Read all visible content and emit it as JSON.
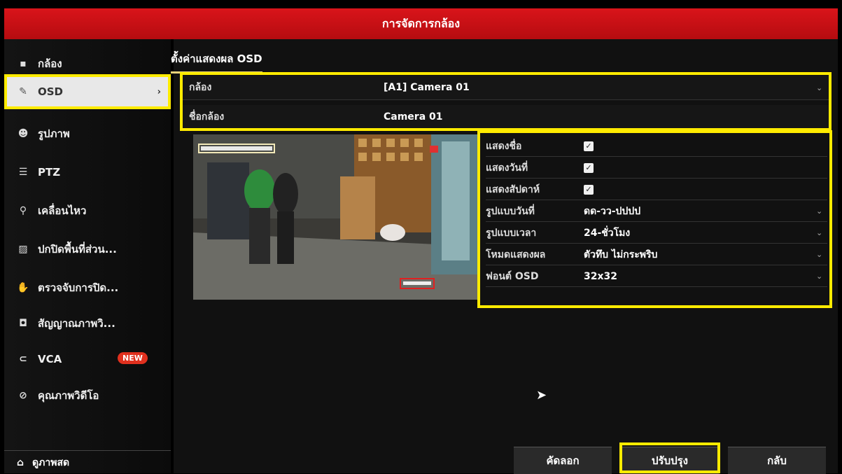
{
  "window": {
    "title": "การจัดการกล้อง"
  },
  "sidebar": {
    "items": [
      {
        "label": "กล้อง",
        "icon": "camera-icon",
        "glyph": "▪"
      },
      {
        "label": "OSD",
        "icon": "osd-edit-icon",
        "glyph": "✎",
        "active": true
      },
      {
        "label": "รูปภาพ",
        "icon": "image-icon",
        "glyph": "☻"
      },
      {
        "label": "PTZ",
        "icon": "ptz-icon",
        "glyph": "☰"
      },
      {
        "label": "เคลื่อนไหว",
        "icon": "motion-icon",
        "glyph": "⚲"
      },
      {
        "label": "ปกปิดพื้นที่ส่วน...",
        "icon": "privacy-mask-icon",
        "glyph": "▨"
      },
      {
        "label": "ตรวจจับการปิด...",
        "icon": "tamper-detect-icon",
        "glyph": "✋"
      },
      {
        "label": "สัญญาณภาพวิ...",
        "icon": "video-loss-icon",
        "glyph": "◘"
      },
      {
        "label": "VCA",
        "icon": "vca-icon",
        "glyph": "⊂",
        "badge": "NEW"
      },
      {
        "label": "คุณภาพวิดีโอ",
        "icon": "video-quality-icon",
        "glyph": "⊘"
      }
    ],
    "live_view": {
      "label": "ดูภาพสด",
      "icon": "home-icon",
      "glyph": "⌂"
    }
  },
  "main": {
    "tab": "ตั้งค่าแสดงผล OSD",
    "camera": {
      "label": "กล้อง",
      "value": "[A1] Camera 01"
    },
    "camera_name": {
      "label": "ชื่อกล้อง",
      "value": "Camera 01"
    },
    "settings": [
      {
        "label": "แสดงชื่อ",
        "type": "checkbox",
        "checked": true
      },
      {
        "label": "แสดงวันที่",
        "type": "checkbox",
        "checked": true
      },
      {
        "label": "แสดงสัปดาห์",
        "type": "checkbox",
        "checked": true
      },
      {
        "label": "รูปแบบวันที่",
        "type": "select",
        "value": "ดด-วว-ปปปป"
      },
      {
        "label": "รูปแบบเวลา",
        "type": "select",
        "value": "24-ชั่วโมง"
      },
      {
        "label": "โหมดแสดงผล",
        "type": "select",
        "value": "ตัวทึบ ไม่กระพริบ"
      },
      {
        "label": "ฟอนต์ OSD",
        "type": "select",
        "value": "32x32"
      }
    ]
  },
  "buttons": {
    "copy": "คัดลอก",
    "apply": "ปรับปรุง",
    "back": "กลับ"
  },
  "colors": {
    "title_red": "#d9141a",
    "highlight_yellow": "#ffeb00",
    "badge_red": "#e0301e"
  }
}
